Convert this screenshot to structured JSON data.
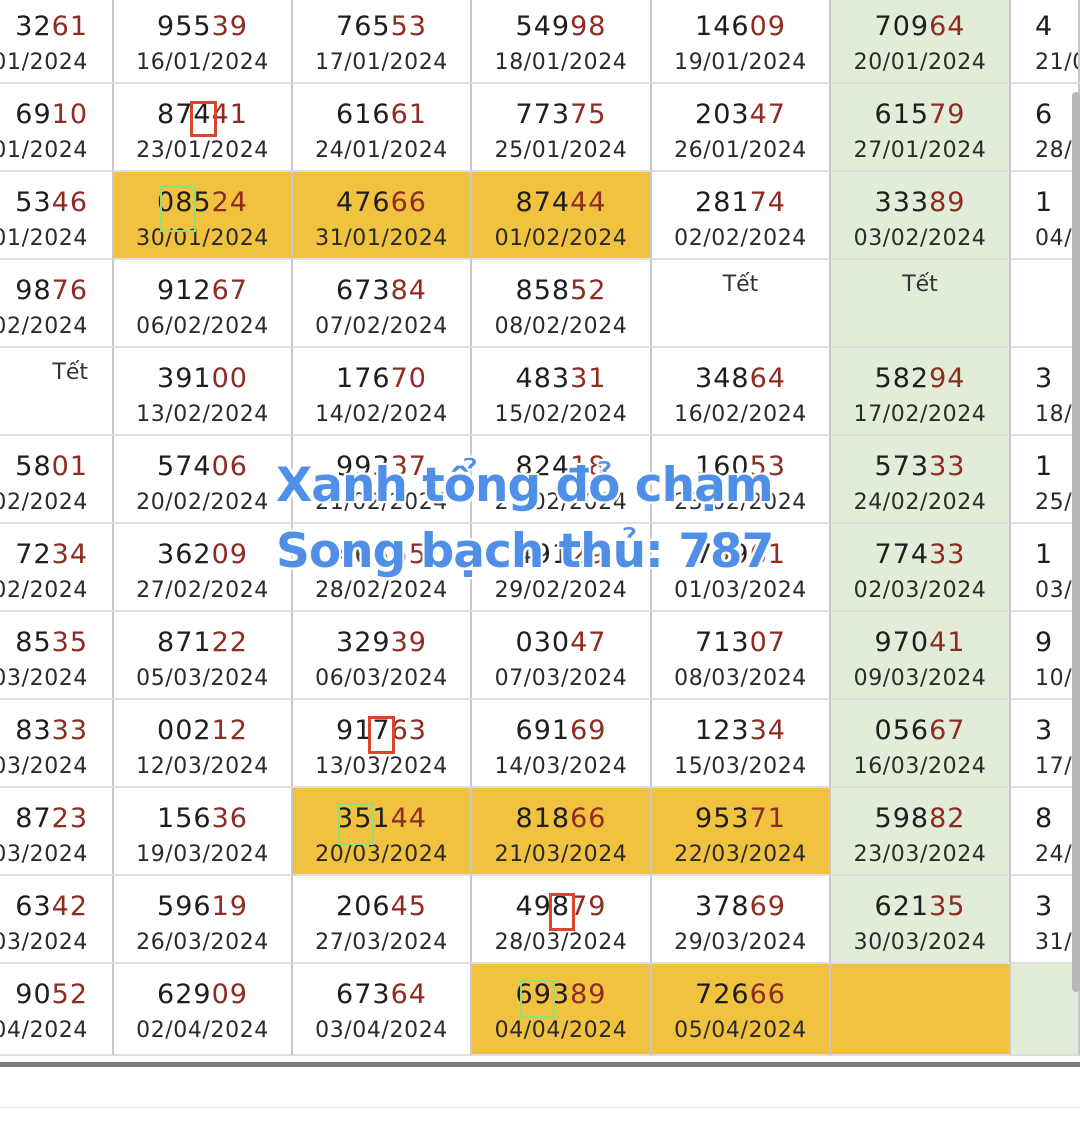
{
  "colors": {
    "red_digits": "#8e2b22",
    "weekend_bg": "#e1ecd9",
    "highlight_bg": "#f1c140",
    "marker_red": "#d9462f",
    "marker_green": "#8fe07a",
    "overlay_text": "#4f8fe8"
  },
  "overlay": {
    "line1": "Xanh tổng đỏ chạm",
    "line2": "Song bạch thủ: 787"
  },
  "rows": [
    [
      {
        "a": "32",
        "b": "61",
        "date": "01/2024"
      },
      {
        "a": "955",
        "b": "39",
        "date": "16/01/2024"
      },
      {
        "a": "765",
        "b": "53",
        "date": "17/01/2024"
      },
      {
        "a": "549",
        "b": "98",
        "date": "18/01/2024"
      },
      {
        "a": "146",
        "b": "09",
        "date": "19/01/2024"
      },
      {
        "a": "709",
        "b": "64",
        "date": "20/01/2024",
        "bg": "green"
      },
      {
        "a": "4",
        "b": "",
        "date": "21/0"
      }
    ],
    [
      {
        "a": "69",
        "b": "10",
        "date": "01/2024"
      },
      {
        "a": "874",
        "b": "41",
        "date": "23/01/2024"
      },
      {
        "a": "616",
        "b": "61",
        "date": "24/01/2024"
      },
      {
        "a": "773",
        "b": "75",
        "date": "25/01/2024"
      },
      {
        "a": "203",
        "b": "47",
        "date": "26/01/2024"
      },
      {
        "a": "615",
        "b": "79",
        "date": "27/01/2024",
        "bg": "green"
      },
      {
        "a": "6",
        "b": "",
        "date": "28/0"
      }
    ],
    [
      {
        "a": "53",
        "b": "46",
        "date": "01/2024"
      },
      {
        "a": "085",
        "b": "24",
        "date": "30/01/2024",
        "bg": "orange"
      },
      {
        "a": "476",
        "b": "66",
        "date": "31/01/2024",
        "bg": "orange"
      },
      {
        "a": "874",
        "b": "44",
        "date": "01/02/2024",
        "bg": "orange"
      },
      {
        "a": "281",
        "b": "74",
        "date": "02/02/2024"
      },
      {
        "a": "333",
        "b": "89",
        "date": "03/02/2024",
        "bg": "green"
      },
      {
        "a": "1",
        "b": "",
        "date": "04/0"
      }
    ],
    [
      {
        "a": "98",
        "b": "76",
        "date": "02/2024"
      },
      {
        "a": "912",
        "b": "67",
        "date": "06/02/2024"
      },
      {
        "a": "673",
        "b": "84",
        "date": "07/02/2024"
      },
      {
        "a": "858",
        "b": "52",
        "date": "08/02/2024"
      },
      {
        "tet": "Tết"
      },
      {
        "tet": "Tết",
        "bg": "green"
      },
      {
        "a": "",
        "b": "",
        "date": ""
      }
    ],
    [
      {
        "tet": "Tết"
      },
      {
        "a": "391",
        "b": "00",
        "date": "13/02/2024"
      },
      {
        "a": "176",
        "b": "70",
        "date": "14/02/2024"
      },
      {
        "a": "483",
        "b": "31",
        "date": "15/02/2024"
      },
      {
        "a": "348",
        "b": "64",
        "date": "16/02/2024"
      },
      {
        "a": "582",
        "b": "94",
        "date": "17/02/2024",
        "bg": "green"
      },
      {
        "a": "3",
        "b": "",
        "date": "18/0"
      }
    ],
    [
      {
        "a": "58",
        "b": "01",
        "date": "02/2024"
      },
      {
        "a": "574",
        "b": "06",
        "date": "20/02/2024"
      },
      {
        "a": "993",
        "b": "37",
        "date": "21/02/2024"
      },
      {
        "a": "824",
        "b": "18",
        "date": "22/02/2024"
      },
      {
        "a": "160",
        "b": "53",
        "date": "23/02/2024"
      },
      {
        "a": "573",
        "b": "33",
        "date": "24/02/2024",
        "bg": "green"
      },
      {
        "a": "1",
        "b": "",
        "date": "25/0"
      }
    ],
    [
      {
        "a": "72",
        "b": "34",
        "date": "02/2024"
      },
      {
        "a": "362",
        "b": "09",
        "date": "27/02/2024"
      },
      {
        "a": "463",
        "b": "55",
        "date": "28/02/2024"
      },
      {
        "a": "491",
        "b": "29",
        "date": "29/02/2024"
      },
      {
        "a": "799",
        "b": "61",
        "date": "01/03/2024"
      },
      {
        "a": "774",
        "b": "33",
        "date": "02/03/2024",
        "bg": "green"
      },
      {
        "a": "1",
        "b": "",
        "date": "03/0"
      }
    ],
    [
      {
        "a": "85",
        "b": "35",
        "date": "03/2024"
      },
      {
        "a": "871",
        "b": "22",
        "date": "05/03/2024"
      },
      {
        "a": "329",
        "b": "39",
        "date": "06/03/2024"
      },
      {
        "a": "030",
        "b": "47",
        "date": "07/03/2024"
      },
      {
        "a": "713",
        "b": "07",
        "date": "08/03/2024"
      },
      {
        "a": "970",
        "b": "41",
        "date": "09/03/2024",
        "bg": "green"
      },
      {
        "a": "9",
        "b": "",
        "date": "10/0"
      }
    ],
    [
      {
        "a": "83",
        "b": "33",
        "date": "03/2024"
      },
      {
        "a": "002",
        "b": "12",
        "date": "12/03/2024"
      },
      {
        "a": "917",
        "b": "63",
        "date": "13/03/2024"
      },
      {
        "a": "691",
        "b": "69",
        "date": "14/03/2024"
      },
      {
        "a": "123",
        "b": "34",
        "date": "15/03/2024"
      },
      {
        "a": "056",
        "b": "67",
        "date": "16/03/2024",
        "bg": "green"
      },
      {
        "a": "3",
        "b": "",
        "date": "17/0"
      }
    ],
    [
      {
        "a": "87",
        "b": "23",
        "date": "03/2024"
      },
      {
        "a": "156",
        "b": "36",
        "date": "19/03/2024"
      },
      {
        "a": "351",
        "b": "44",
        "date": "20/03/2024",
        "bg": "orange"
      },
      {
        "a": "818",
        "b": "66",
        "date": "21/03/2024",
        "bg": "orange"
      },
      {
        "a": "953",
        "b": "71",
        "date": "22/03/2024",
        "bg": "orange"
      },
      {
        "a": "598",
        "b": "82",
        "date": "23/03/2024",
        "bg": "green"
      },
      {
        "a": "8",
        "b": "",
        "date": "24/0"
      }
    ],
    [
      {
        "a": "63",
        "b": "42",
        "date": "03/2024"
      },
      {
        "a": "596",
        "b": "19",
        "date": "26/03/2024"
      },
      {
        "a": "206",
        "b": "45",
        "date": "27/03/2024"
      },
      {
        "a": "498",
        "b": "79",
        "date": "28/03/2024"
      },
      {
        "a": "378",
        "b": "69",
        "date": "29/03/2024"
      },
      {
        "a": "621",
        "b": "35",
        "date": "30/03/2024",
        "bg": "green"
      },
      {
        "a": "3",
        "b": "",
        "date": "31/0"
      }
    ],
    [
      {
        "a": "90",
        "b": "52",
        "date": "04/2024"
      },
      {
        "a": "629",
        "b": "09",
        "date": "02/04/2024"
      },
      {
        "a": "673",
        "b": "64",
        "date": "03/04/2024"
      },
      {
        "a": "693",
        "b": "89",
        "date": "04/04/2024",
        "bg": "orange"
      },
      {
        "a": "726",
        "b": "66",
        "date": "05/04/2024",
        "bg": "orange"
      },
      {
        "a": "",
        "b": "",
        "date": "",
        "bg": "orange"
      },
      {
        "a": "",
        "b": "",
        "date": "",
        "bg": "green"
      }
    ]
  ]
}
